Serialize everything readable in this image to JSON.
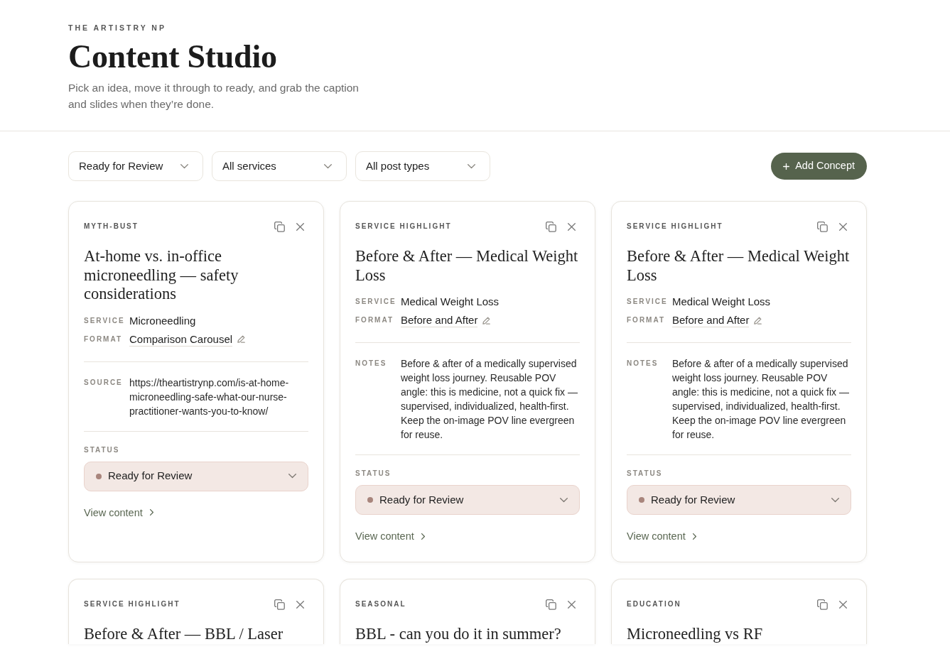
{
  "header": {
    "brand": "THE ARTISTRY NP",
    "title": "Content Studio",
    "subtitle": "Pick an idea, move it through to ready, and grab the caption and slides when they’re done."
  },
  "filters": [
    {
      "value": "Ready for Review"
    },
    {
      "value": "All services"
    },
    {
      "value": "All post types"
    }
  ],
  "add_button": {
    "label": "Add Concept"
  },
  "cards": [
    {
      "category": "MYTH-BUST",
      "title": "At-home vs. in-office microneedling — safety considerations",
      "fields": [
        {
          "label": "SERVICE",
          "value": "Microneedling",
          "editable": false
        },
        {
          "label": "FORMAT",
          "value": "Comparison Carousel",
          "editable": true
        }
      ],
      "details": [
        {
          "label": "SOURCE",
          "value": "https://theartistrynp.com/is-at-home-microneedling-safe-what-our-nurse-practitioner-wants-you-to-know/"
        }
      ],
      "status_label": "STATUS",
      "status": {
        "value": "Ready for Review",
        "color": "#a8857c"
      },
      "link": "View content"
    },
    {
      "category": "SERVICE HIGHLIGHT",
      "title": "Before & After — Medical Weight Loss",
      "fields": [
        {
          "label": "SERVICE",
          "value": "Medical Weight Loss",
          "editable": false
        },
        {
          "label": "FORMAT",
          "value": "Before and After",
          "editable": true
        }
      ],
      "details": [
        {
          "label": "NOTES",
          "value": "Before & after of a medically supervised weight loss journey. Reusable POV angle: this is medicine, not a quick fix — supervised, individualized, health-first. Keep the on-image POV line evergreen for reuse."
        }
      ],
      "status_label": "STATUS",
      "status": {
        "value": "Ready for Review",
        "color": "#a8857c"
      },
      "link": "View content"
    },
    {
      "category": "SERVICE HIGHLIGHT",
      "title": "Before & After — Medical Weight Loss",
      "fields": [
        {
          "label": "SERVICE",
          "value": "Medical Weight Loss",
          "editable": false
        },
        {
          "label": "FORMAT",
          "value": "Before and After",
          "editable": true
        }
      ],
      "details": [
        {
          "label": "NOTES",
          "value": "Before & after of a medically supervised weight loss journey. Reusable POV angle: this is medicine, not a quick fix — supervised, individualized, health-first. Keep the on-image POV line evergreen for reuse."
        }
      ],
      "status_label": "STATUS",
      "status": {
        "value": "Ready for Review",
        "color": "#a8857c"
      },
      "link": "View content"
    },
    {
      "category": "SERVICE HIGHLIGHT",
      "title": "Before & After — BBL / Laser"
    },
    {
      "category": "SEASONAL",
      "title": "BBL - can you do it in summer?"
    },
    {
      "category": "EDUCATION",
      "title": "Microneedling vs RF"
    }
  ]
}
